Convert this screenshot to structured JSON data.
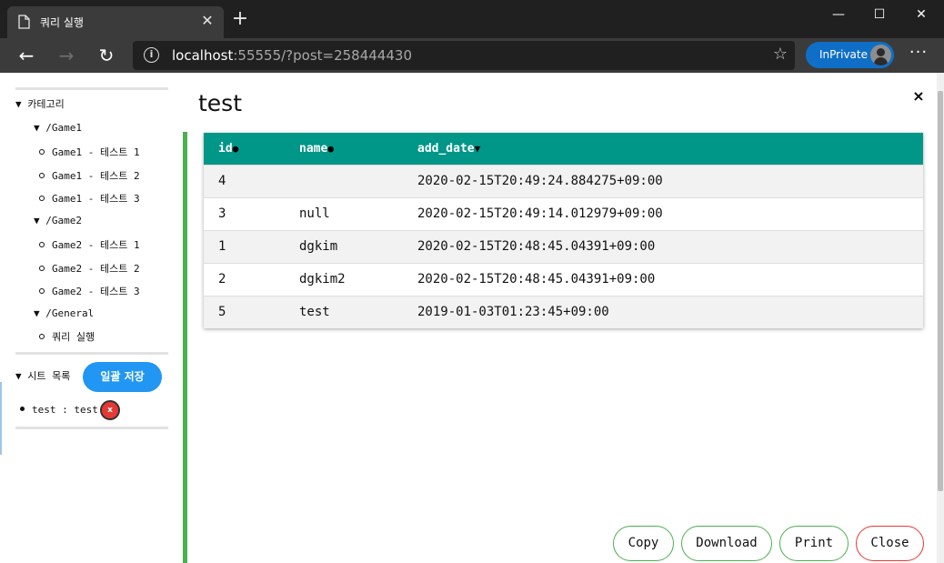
{
  "browser": {
    "tab_title": "쿼리 실행",
    "url_host": "localhost",
    "url_rest": ":55555/?post=258444430",
    "inprivate_label": "InPrivate",
    "tab_close_icon": "close-icon",
    "new_tab_icon": "plus-icon",
    "win_controls": [
      "minimize-icon",
      "maximize-icon",
      "close-icon"
    ],
    "back_icon": "←",
    "forward_icon": "→",
    "refresh_icon": "↻",
    "info_icon": "i",
    "favorite_icon": "☆",
    "more_icon": "···",
    "minimize_glyph": "—",
    "maximize_glyph": "☐",
    "close_glyph": "✕",
    "tab_close_glyph": "✕",
    "new_tab_glyph": "+"
  },
  "sidebar": {
    "category_header": "▼ 카테고리",
    "groups": [
      {
        "label": "▼ /Game1",
        "items": [
          "Game1 - 테스트 1",
          "Game1 - 테스트 2",
          "Game1 - 테스트 3"
        ]
      },
      {
        "label": "▼ /Game2",
        "items": [
          "Game2 - 테스트 1",
          "Game2 - 테스트 2",
          "Game2 - 테스트 3"
        ]
      },
      {
        "label": "▼ /General",
        "items": [
          "쿼리 실행"
        ]
      }
    ],
    "sheet_header": "▼ 시트 목록",
    "save_all_label": "일괄 저장",
    "sheets": [
      "test : test"
    ],
    "delete_label": "x"
  },
  "modal": {
    "title": "test",
    "close_label": "×",
    "table": {
      "columns": [
        "id",
        "name",
        "add_date"
      ],
      "sort_marks": [
        "●",
        "●",
        "▼"
      ],
      "rows": [
        [
          "4",
          "",
          "2020-02-15T20:49:24.884275+09:00"
        ],
        [
          "3",
          "null",
          "2020-02-15T20:49:14.012979+09:00"
        ],
        [
          "1",
          "dgkim",
          "2020-02-15T20:48:45.04391+09:00"
        ],
        [
          "2",
          "dgkim2",
          "2020-02-15T20:48:45.04391+09:00"
        ],
        [
          "5",
          "test",
          "2019-01-03T01:23:45+09:00"
        ]
      ]
    },
    "buttons": {
      "copy": "Copy",
      "download": "Download",
      "print": "Print",
      "close": "Close"
    }
  },
  "colors": {
    "header_teal": "#009688",
    "accent_green": "#4caf50",
    "save_blue": "#2196f3",
    "danger_red": "#e53935",
    "inprivate_blue": "#0f6fc6"
  }
}
